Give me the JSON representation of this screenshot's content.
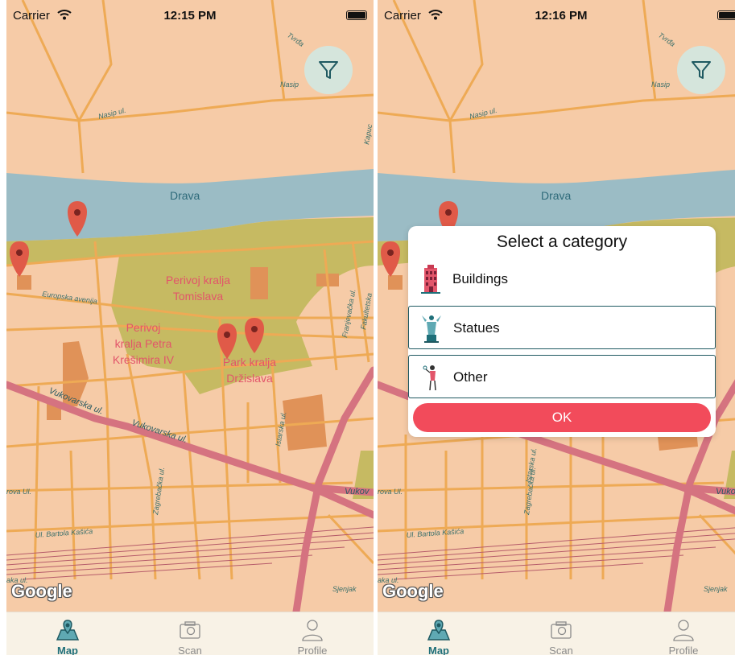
{
  "left": {
    "status": {
      "carrier": "Carrier",
      "time": "12:15 PM"
    },
    "map": {
      "river": "Drava",
      "labels": {
        "nasip": "Nasip ul.",
        "nasip2": "Nasip",
        "tvrda": "Tvrđa",
        "europska": "Europska avenija",
        "vukovarska1": "Vukovarska ul.",
        "vukovarska2": "Vukovarska ul.",
        "vukovarska3": "Vukov",
        "rova": "rova Ul.",
        "zagrebacka": "Zagrebačka ul.",
        "istarska": "Istarska ul.",
        "franjevacka": "Franjevačka ul.",
        "fakultetska": "Fakultetska",
        "kapucinska": "Kapuc",
        "bartola": "Ul. Bartola Kašića",
        "sjenjak": "Sjenjak",
        "aka": "aka ul."
      },
      "parks": {
        "tomislav": [
          "Perivoj kralja",
          "Tomislava"
        ],
        "petar": [
          "Perivoj",
          "kralja Petra",
          "Krešimira IV"
        ],
        "drzislav": [
          "Park kralja",
          "Držislava"
        ]
      },
      "attribution": "Google"
    }
  },
  "right": {
    "status": {
      "carrier": "Carrier",
      "time": "12:16 PM"
    },
    "dialog": {
      "title": "Select a category",
      "options": [
        {
          "label": "Buildings",
          "icon": "building-icon",
          "selected": false
        },
        {
          "label": "Statues",
          "icon": "statue-icon",
          "selected": true
        },
        {
          "label": "Other",
          "icon": "other-icon",
          "selected": true
        }
      ],
      "ok": "OK"
    }
  },
  "tabs": [
    {
      "label": "Map",
      "icon": "map-pin-icon",
      "active": true
    },
    {
      "label": "Scan",
      "icon": "camera-icon",
      "active": false
    },
    {
      "label": "Profile",
      "icon": "profile-icon",
      "active": false
    }
  ],
  "colors": {
    "land": "#f6cba7",
    "road": "#eeaa55",
    "major_road": "#d57380",
    "river": "#9bbcc5",
    "park": "#c6ba62",
    "marker": "#e05a48",
    "accent": "#1f6f79",
    "ok": "#f24b5b"
  }
}
